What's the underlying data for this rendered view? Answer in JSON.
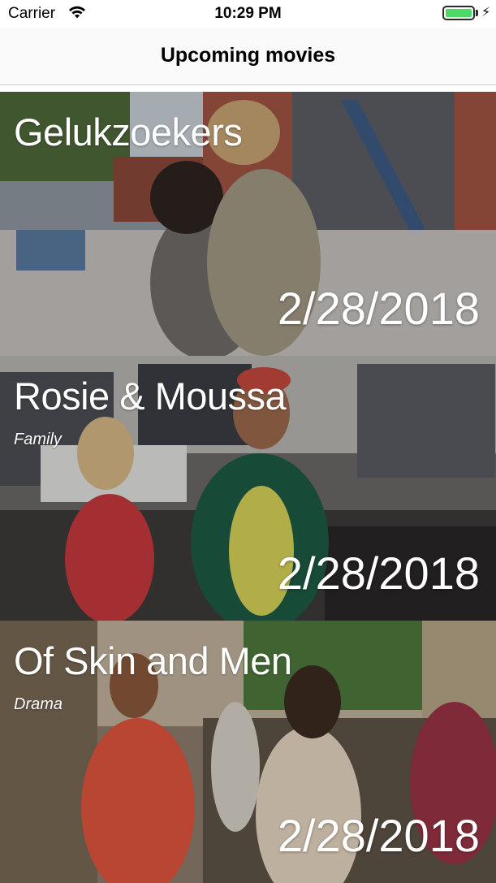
{
  "status_bar": {
    "carrier": "Carrier",
    "time": "10:29 PM"
  },
  "nav": {
    "title": "Upcoming movies"
  },
  "movies": [
    {
      "title": "Gelukzoekers",
      "genre": "",
      "date": "2/28/2018"
    },
    {
      "title": "Rosie & Moussa",
      "genre": "Family",
      "date": "2/28/2018"
    },
    {
      "title": "Of Skin and Men",
      "genre": "Drama",
      "date": "2/28/2018"
    }
  ],
  "colors": {
    "battery": "#4cd964",
    "separator": "#c8c7cc"
  }
}
